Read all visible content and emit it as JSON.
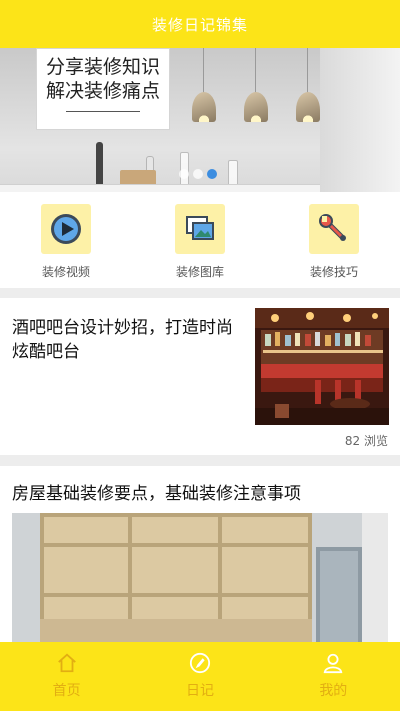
{
  "header": {
    "title": "装修日记锦集"
  },
  "banner": {
    "sign_lines": [
      "分享装修知识",
      "解决装修痛点"
    ],
    "slide_count": 3,
    "active_slide": 3
  },
  "quick_links": [
    {
      "label": "装修视频",
      "icon": "video-play-icon"
    },
    {
      "label": "装修图库",
      "icon": "gallery-icon"
    },
    {
      "label": "装修技巧",
      "icon": "wrench-icon"
    }
  ],
  "articles": [
    {
      "title": "酒吧吧台设计妙招，打造时尚炫酷吧台",
      "views": "82 浏览",
      "thumbnail": "bar-counter-photo"
    },
    {
      "title": "房屋基础装修要点，基础装修注意事项",
      "thumbnail": "wooden-wall-photo"
    }
  ],
  "bottom_nav": [
    {
      "label": "首页",
      "icon": "home-icon"
    },
    {
      "label": "日记",
      "icon": "compass-icon"
    },
    {
      "label": "我的",
      "icon": "user-icon"
    }
  ],
  "colors": {
    "primary": "#fce418",
    "nav_text": "#e2ae12",
    "icon_bg": "#fdf1a7",
    "active_dot": "#3c8de0"
  }
}
